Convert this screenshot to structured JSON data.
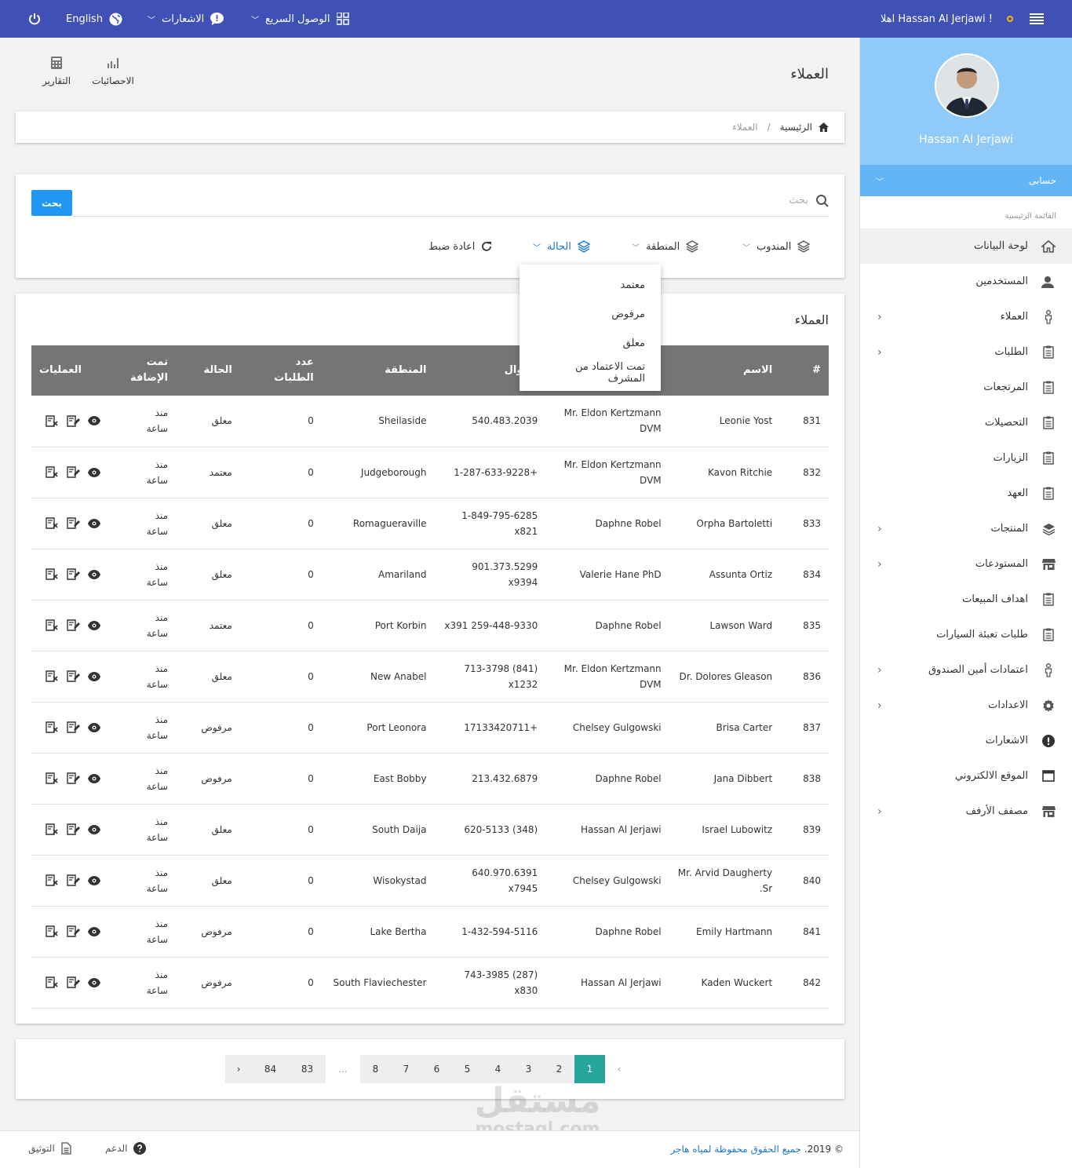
{
  "topbar": {
    "greeting": "اهلا Hassan Al Jerjawi !",
    "quick_access": "الوصول السريع",
    "notifications": "الاشعارات",
    "language": "English"
  },
  "sidebar": {
    "user_name": "Hassan Al Jerjawi",
    "account_label": "حسابى",
    "menu_heading": "القائمة الرئيسية",
    "items": [
      {
        "label": "لوحة البيانات",
        "icon": "home-icon",
        "chevron": false
      },
      {
        "label": "المستخدمين",
        "icon": "users-icon",
        "chevron": false
      },
      {
        "label": "العملاء",
        "icon": "person-icon",
        "chevron": true
      },
      {
        "label": "الطلبات",
        "icon": "clipboard-icon",
        "chevron": true
      },
      {
        "label": "المرتجعات",
        "icon": "clipboard-icon",
        "chevron": false
      },
      {
        "label": "التحصيلات",
        "icon": "clipboard-icon",
        "chevron": false
      },
      {
        "label": "الزيارات",
        "icon": "clipboard-icon",
        "chevron": false
      },
      {
        "label": "العهد",
        "icon": "clipboard-icon",
        "chevron": false
      },
      {
        "label": "المنتجات",
        "icon": "layers-icon",
        "chevron": true
      },
      {
        "label": "المستودعات",
        "icon": "store-icon",
        "chevron": true
      },
      {
        "label": "اهداف المبيعات",
        "icon": "clipboard-icon",
        "chevron": false
      },
      {
        "label": "طلبات تعبئة السيارات",
        "icon": "clipboard-icon",
        "chevron": false
      },
      {
        "label": "اعتمادات أمين الصندوق",
        "icon": "person-icon",
        "chevron": true
      },
      {
        "label": "الاعدادات",
        "icon": "gear-icon",
        "chevron": true
      },
      {
        "label": "الاشعارات",
        "icon": "alert-icon",
        "chevron": false
      },
      {
        "label": "الموقع الالكتروني",
        "icon": "window-icon",
        "chevron": false
      },
      {
        "label": "مصفف الأرفف",
        "icon": "store-icon",
        "chevron": true
      }
    ]
  },
  "page": {
    "title": "العملاء",
    "statistics": "الاحصائيات",
    "reports": "التقارير"
  },
  "breadcrumb": {
    "home": "الرئيسية",
    "current": "العملاء"
  },
  "filters": {
    "search_placeholder": "بحث",
    "search_button": "بحث",
    "rep": "المندوب",
    "region": "المنطقة",
    "status": "الحالة",
    "reset": "اعادة ضبط",
    "status_options": [
      "معتمد",
      "مرفوض",
      "معلق",
      "تمت الاعتماد من المشرف"
    ]
  },
  "table": {
    "title": "العملاء",
    "headers": [
      "#",
      "الاسم",
      "",
      "الجوال",
      "المنطقة",
      "عدد الطلبات",
      "الحالة",
      "تمت الإضافة",
      "العمليات"
    ],
    "rows": [
      {
        "id": "831",
        "name": "Leonie Yost",
        "rep": "Mr. Eldon Kertzmann DVM",
        "phone": "540.483.2039",
        "region": "Sheilaside",
        "orders": "0",
        "status": "معلق",
        "added": "منذ ساعة"
      },
      {
        "id": "832",
        "name": "Kavon Ritchie",
        "rep": "Mr. Eldon Kertzmann DVM",
        "phone": "+1-287-633-9228",
        "region": "Judgeborough",
        "orders": "0",
        "status": "معتمد",
        "added": "منذ ساعة"
      },
      {
        "id": "833",
        "name": "Orpha Bartoletti",
        "rep": "Daphne Robel",
        "phone": "1-849-795-6285 x821",
        "region": "Romagueraville",
        "orders": "0",
        "status": "معلق",
        "added": "منذ ساعة"
      },
      {
        "id": "834",
        "name": "Assunta Ortiz",
        "rep": "Valerie Hane PhD",
        "phone": "901.373.5299 x9394",
        "region": "Amariland",
        "orders": "0",
        "status": "معلق",
        "added": "منذ ساعة"
      },
      {
        "id": "835",
        "name": "Lawson Ward",
        "rep": "Daphne Robel",
        "phone": "259-448-9330 x391",
        "region": "Port Korbin",
        "orders": "0",
        "status": "معتمد",
        "added": "منذ ساعة"
      },
      {
        "id": "836",
        "name": "Dr. Dolores Gleason",
        "rep": "Mr. Eldon Kertzmann DVM",
        "phone": "(841) 713-3798 x1232",
        "region": "New Anabel",
        "orders": "0",
        "status": "معلق",
        "added": "منذ ساعة"
      },
      {
        "id": "837",
        "name": "Brisa Carter",
        "rep": "Chelsey Gulgowski",
        "phone": "+17133420711",
        "region": "Port Leonora",
        "orders": "0",
        "status": "مرفوض",
        "added": "منذ ساعة"
      },
      {
        "id": "838",
        "name": "Jana Dibbert",
        "rep": "Daphne Robel",
        "phone": "213.432.6879",
        "region": "East Bobby",
        "orders": "0",
        "status": "مرفوض",
        "added": "منذ ساعة"
      },
      {
        "id": "839",
        "name": "Israel Lubowitz",
        "rep": "Hassan Al Jerjawi",
        "phone": "(348) 620-5133",
        "region": "South Daija",
        "orders": "0",
        "status": "معلق",
        "added": "منذ ساعة"
      },
      {
        "id": "840",
        "name": "Mr. Arvid Daugherty Sr.",
        "rep": "Chelsey Gulgowski",
        "phone": "640.970.6391 x7945",
        "region": "Wisokystad",
        "orders": "0",
        "status": "معلق",
        "added": "منذ ساعة"
      },
      {
        "id": "841",
        "name": "Emily Hartmann",
        "rep": "Daphne Robel",
        "phone": "1-432-594-5116",
        "region": "Lake Bertha",
        "orders": "0",
        "status": "مرفوض",
        "added": "منذ ساعة"
      },
      {
        "id": "842",
        "name": "Kaden Wuckert",
        "rep": "Hassan Al Jerjawi",
        "phone": "(287) 743-3985 x830",
        "region": "South Flaviechester",
        "orders": "0",
        "status": "مرفوض",
        "added": "منذ ساعة"
      }
    ]
  },
  "pagination": {
    "prev": "‹",
    "pages": [
      "1",
      "2",
      "3",
      "4",
      "5",
      "6",
      "7",
      "8"
    ],
    "ellipsis": "...",
    "last_pages": [
      "83",
      "84"
    ],
    "next": "›",
    "active": "1"
  },
  "footer": {
    "copyright_prefix": "© 2019.",
    "copyright_link": "جميع الحقوق محفوظة لمياه هاجر",
    "support": "الدعم",
    "docs": "التوثيق"
  },
  "watermark": {
    "line1": "مستقل",
    "line2": "mostaql.com"
  },
  "colors": {
    "topbar": "#3f51b5",
    "profile": "#90caf9",
    "account_bar": "#64b5f6",
    "primary_button": "#2196f3",
    "active_page": "#26a69a",
    "table_header": "#757575"
  }
}
